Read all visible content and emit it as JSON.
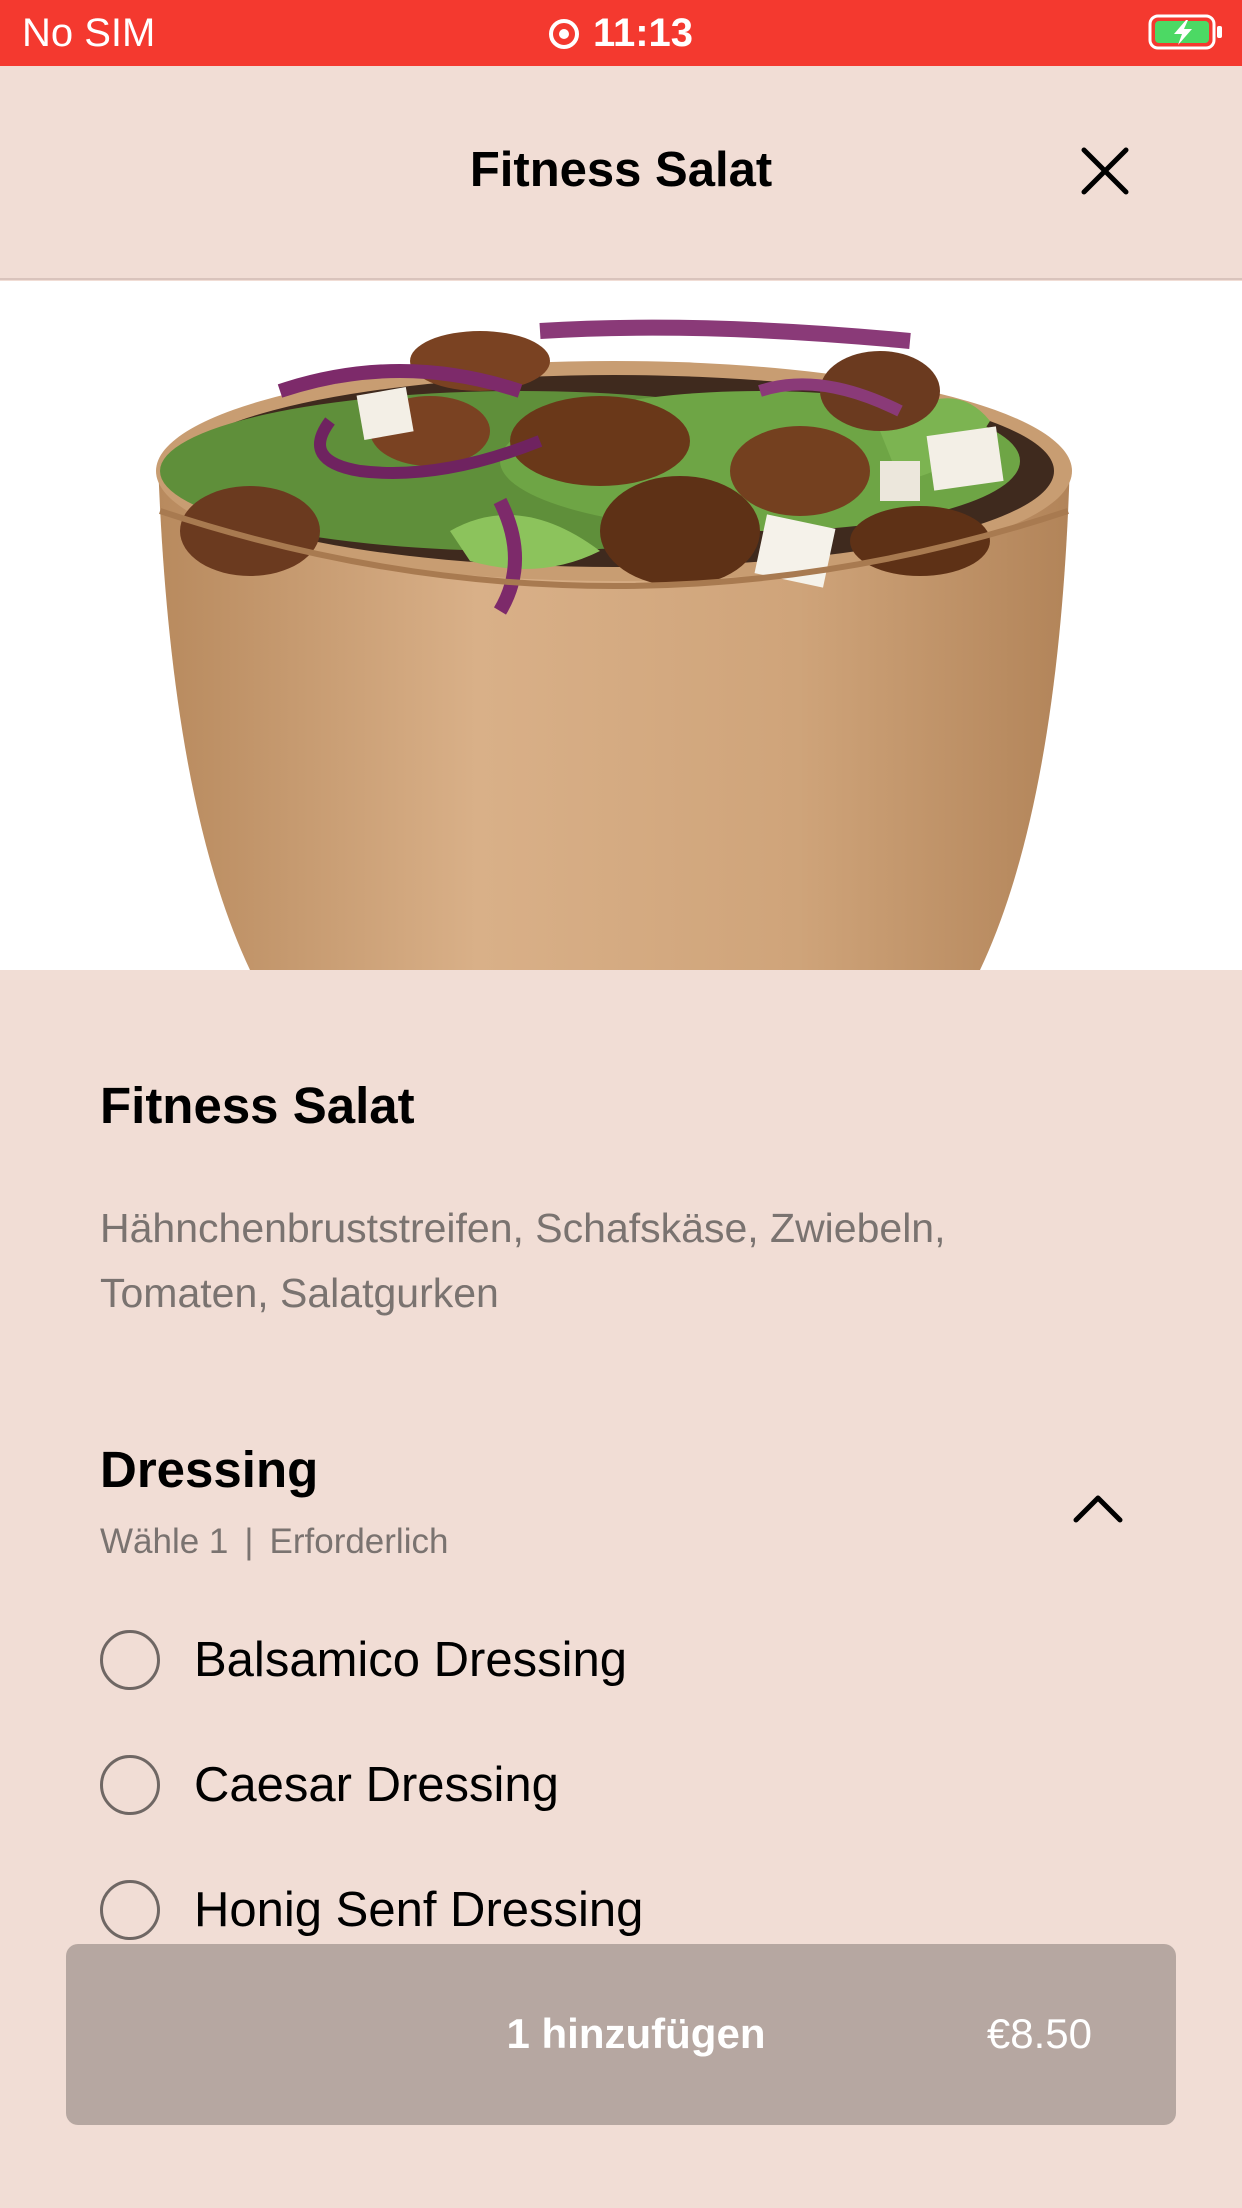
{
  "status_bar": {
    "carrier": "No SIM",
    "time": "11:13",
    "background_color": "#f4392f",
    "battery_color": "#4cd964"
  },
  "header": {
    "title": "Fitness Salat",
    "close_icon": "close-icon"
  },
  "product": {
    "image_icon": "salad-bowl-image",
    "title": "Fitness Salat",
    "description": "Hähnchenbruststreifen, Schafskäse, Zwiebeln, Tomaten, Salatgurken"
  },
  "dressing_section": {
    "title": "Dressing",
    "choose_text": "Wähle 1",
    "separator": "|",
    "required_text": "Erforderlich",
    "collapse_icon": "chevron-up-icon",
    "options": [
      {
        "label": "Balsamico Dressing",
        "selected": false
      },
      {
        "label": "Caesar Dressing",
        "selected": false
      },
      {
        "label": "Honig Senf Dressing",
        "selected": false
      }
    ]
  },
  "cart_button": {
    "label": "1 hinzufügen",
    "price": "€8.50",
    "background_color": "#b6a7a1"
  },
  "theme": {
    "background": "#f1ddd5",
    "text_primary": "#000000",
    "text_secondary": "#7a7370"
  }
}
